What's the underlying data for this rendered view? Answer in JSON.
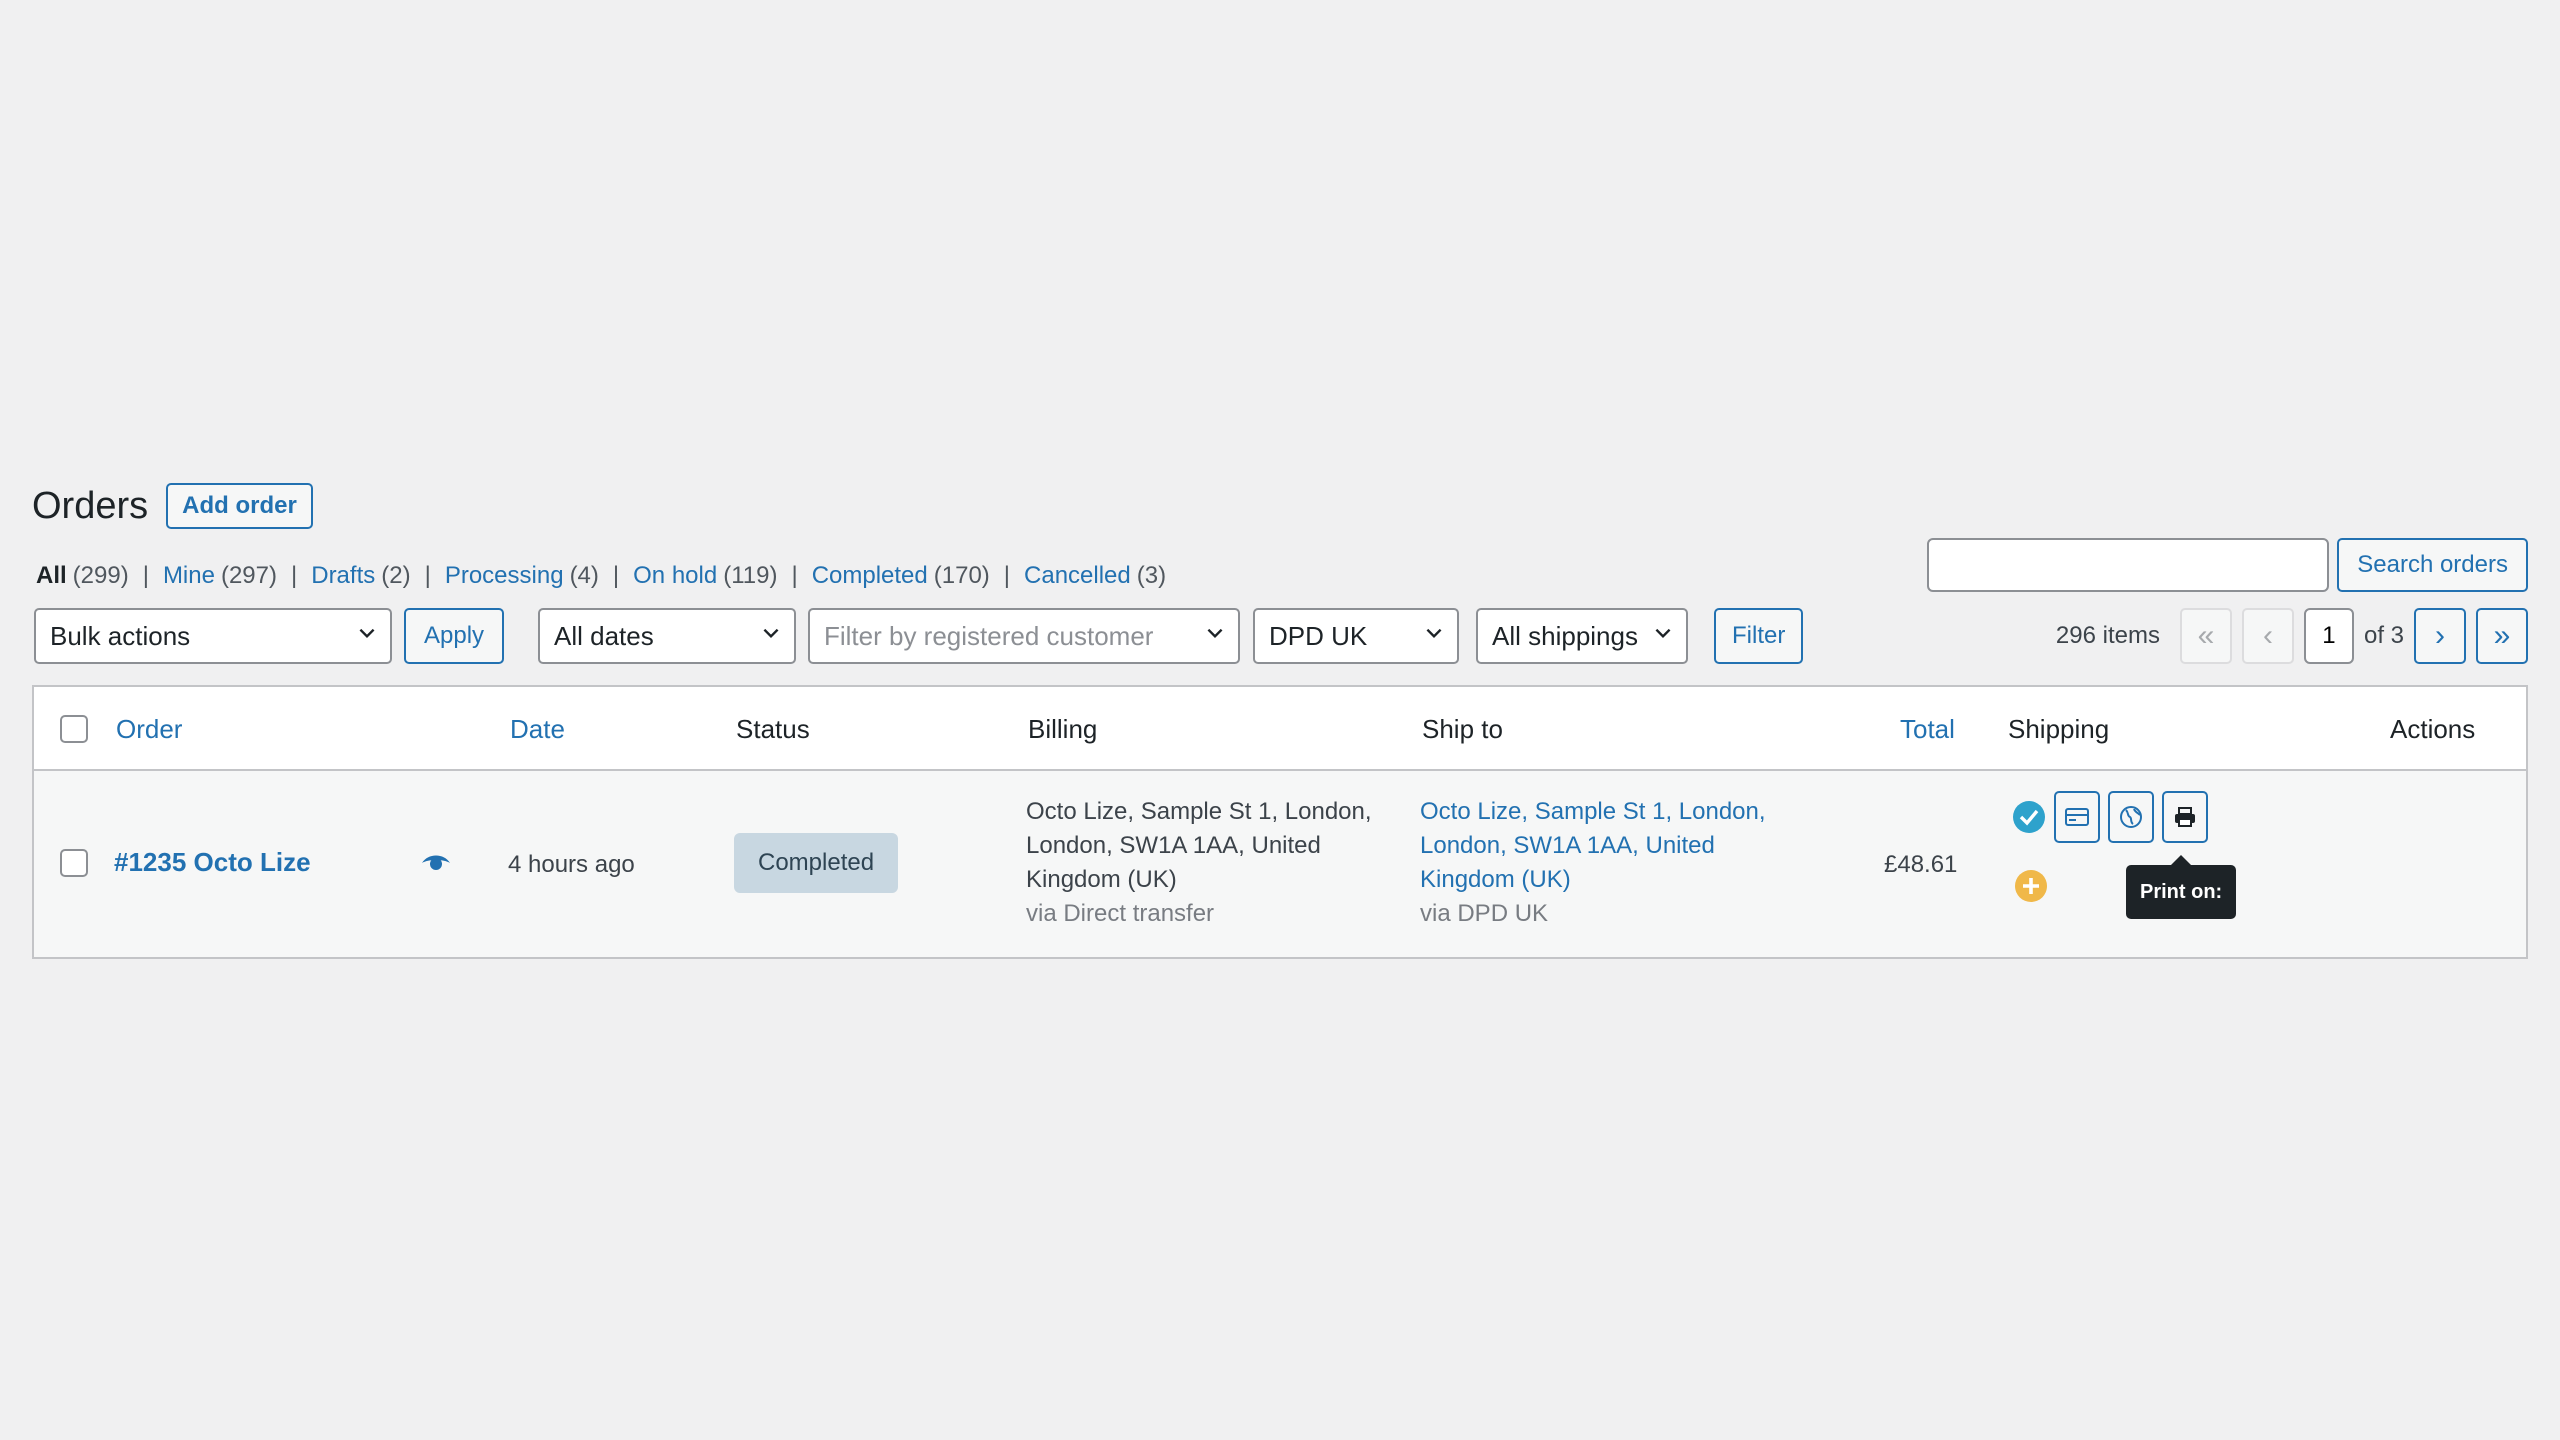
{
  "header": {
    "title": "Orders",
    "add_order_label": "Add order"
  },
  "views": [
    {
      "label": "All",
      "count": "(299)",
      "current": true
    },
    {
      "label": "Mine",
      "count": "(297)"
    },
    {
      "label": "Drafts",
      "count": "(2)"
    },
    {
      "label": "Processing",
      "count": "(4)"
    },
    {
      "label": "On hold",
      "count": "(119)"
    },
    {
      "label": "Completed",
      "count": "(170)"
    },
    {
      "label": "Cancelled",
      "count": "(3)"
    }
  ],
  "search": {
    "value": "",
    "button_label": "Search orders"
  },
  "tablenav": {
    "bulk_actions": "Bulk actions",
    "apply_label": "Apply",
    "dates": "All dates",
    "customer_placeholder": "Filter by registered customer",
    "carrier": "DPD UK",
    "shippings": "All shippings",
    "filter_label": "Filter",
    "items_count": "296 items",
    "first_page": "«",
    "prev_page": "‹",
    "current_page": "1",
    "of_pages": "of 3",
    "next_page": "›",
    "last_page": "»"
  },
  "columns": {
    "order": "Order",
    "date": "Date",
    "status": "Status",
    "billing": "Billing",
    "ship_to": "Ship to",
    "total": "Total",
    "shipping": "Shipping",
    "actions": "Actions"
  },
  "rows": [
    {
      "order": "#1235 Octo Lize",
      "date": "4 hours ago",
      "status": "Completed",
      "billing_line1": "Octo Lize, Sample St 1, London,",
      "billing_line2": "London, SW1A 1AA, United",
      "billing_line3": "Kingdom (UK)",
      "billing_via": "via Direct transfer",
      "ship_line1": "Octo Lize, Sample St 1, London,",
      "ship_line2": "London, SW1A 1AA, United",
      "ship_line3": "Kingdom (UK)",
      "ship_via": "via DPD UK",
      "total": "£48.61"
    }
  ],
  "tooltip": "Print on:",
  "colors": {
    "accent": "#2271b1",
    "check_badge": "#2ea2cc",
    "warning": "#f0b849",
    "status_completed_bg": "#c8d7e1"
  },
  "icons": {
    "preview": "eye-icon",
    "shipped": "check-circle-icon",
    "label": "label-icon",
    "tracking": "globe-icon",
    "print": "printer-icon",
    "add": "plus-circle-icon"
  }
}
